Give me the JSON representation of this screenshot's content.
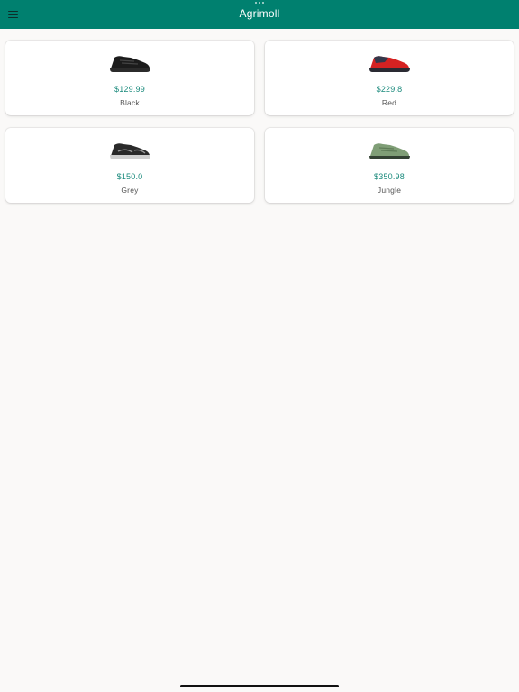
{
  "app": {
    "title": "Agrimoll"
  },
  "colors": {
    "appbar": "#00806f",
    "price": "#1a8a7c",
    "background": "#faf9f8"
  },
  "icons": {
    "menu": "hamburger-menu-icon"
  },
  "products": [
    {
      "price": "$129.99",
      "color": "Black",
      "image": "black-shoe-image",
      "upper": "#1c1c1c",
      "sole": "#2b2b2b",
      "accent": "#444444"
    },
    {
      "price": "$229.8",
      "color": "Red",
      "image": "red-shoe-image",
      "upper": "#d42222",
      "sole": "#2a2a33",
      "accent": "#33374a"
    },
    {
      "price": "$150.0",
      "color": "Grey",
      "image": "grey-shoe-image",
      "upper": "#2a2a2a",
      "sole": "#cfcfcf",
      "accent": "#9a9a9a"
    },
    {
      "price": "$350.98",
      "color": "Jungle",
      "image": "jungle-shoe-image",
      "upper": "#7f9e76",
      "sole": "#334233",
      "accent": "#5f7d58"
    }
  ]
}
